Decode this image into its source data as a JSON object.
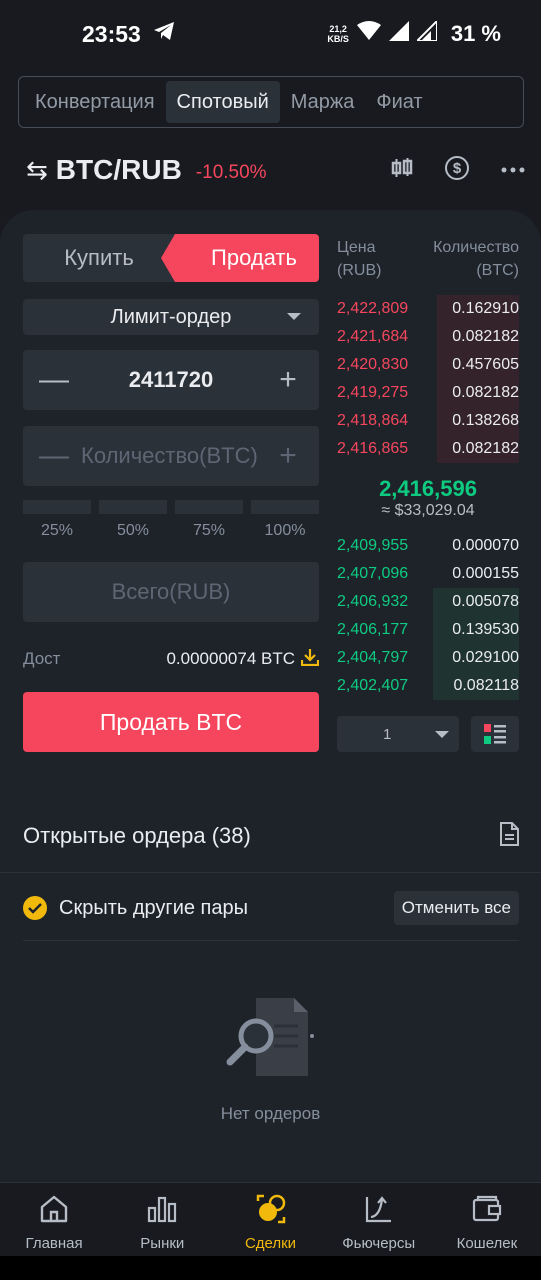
{
  "status_bar": {
    "time": "23:53",
    "net_speed": "21,2",
    "net_unit": "KB/S",
    "battery": "31 %"
  },
  "tabs": [
    {
      "label": "Конвертация"
    },
    {
      "label": "Спотовый",
      "active": true
    },
    {
      "label": "Маржа"
    },
    {
      "label": "Фиат"
    }
  ],
  "pair": {
    "name": "BTC/RUB",
    "change": "-10.50%"
  },
  "trade_form": {
    "buy_label": "Купить",
    "sell_label": "Продать",
    "order_type": "Лимит-ордер",
    "price_value": "2411720",
    "qty_placeholder": "Количество(BTC)",
    "percents": [
      "25%",
      "50%",
      "75%",
      "100%"
    ],
    "total_placeholder": "Всего(RUB)",
    "available_label": "Дост",
    "available_value": "0.00000074 BTC",
    "submit_label": "Продать BTC"
  },
  "orderbook": {
    "price_header": "Цена",
    "price_unit": "(RUB)",
    "qty_header": "Количество",
    "qty_unit": "(BTC)",
    "asks": [
      {
        "price": "2,422,809",
        "qty": "0.162910",
        "depth": 0.45
      },
      {
        "price": "2,421,684",
        "qty": "0.082182",
        "depth": 0.45
      },
      {
        "price": "2,420,830",
        "qty": "0.457605",
        "depth": 0.45
      },
      {
        "price": "2,419,275",
        "qty": "0.082182",
        "depth": 0.45
      },
      {
        "price": "2,418,864",
        "qty": "0.138268",
        "depth": 0.45
      },
      {
        "price": "2,416,865",
        "qty": "0.082182",
        "depth": 0.45
      }
    ],
    "mid_price": "2,416,596",
    "mid_fiat": "≈ $33,029.04",
    "bids": [
      {
        "price": "2,409,955",
        "qty": "0.000070",
        "depth": 0.0
      },
      {
        "price": "2,407,096",
        "qty": "0.000155",
        "depth": 0.0
      },
      {
        "price": "2,406,932",
        "qty": "0.005078",
        "depth": 0.47
      },
      {
        "price": "2,406,177",
        "qty": "0.139530",
        "depth": 0.47
      },
      {
        "price": "2,404,797",
        "qty": "0.029100",
        "depth": 0.47
      },
      {
        "price": "2,402,407",
        "qty": "0.082118",
        "depth": 0.47
      }
    ],
    "depth_value": "1"
  },
  "open_orders": {
    "title": "Открытые ордера (38)",
    "hide_pairs_label": "Скрыть другие пары",
    "cancel_all_label": "Отменить все",
    "empty_text": "Нет ордеров"
  },
  "bottom_nav": [
    {
      "label": "Главная",
      "icon": "home-icon"
    },
    {
      "label": "Рынки",
      "icon": "markets-icon"
    },
    {
      "label": "Сделки",
      "icon": "trades-icon",
      "active": true
    },
    {
      "label": "Фьючерсы",
      "icon": "futures-icon"
    },
    {
      "label": "Кошелек",
      "icon": "wallet-icon"
    }
  ],
  "colors": {
    "background": "#181a20",
    "panel": "#1e2329",
    "accent": "#f0b90b",
    "sell": "#f6465d",
    "buy": "#0ecb81"
  }
}
